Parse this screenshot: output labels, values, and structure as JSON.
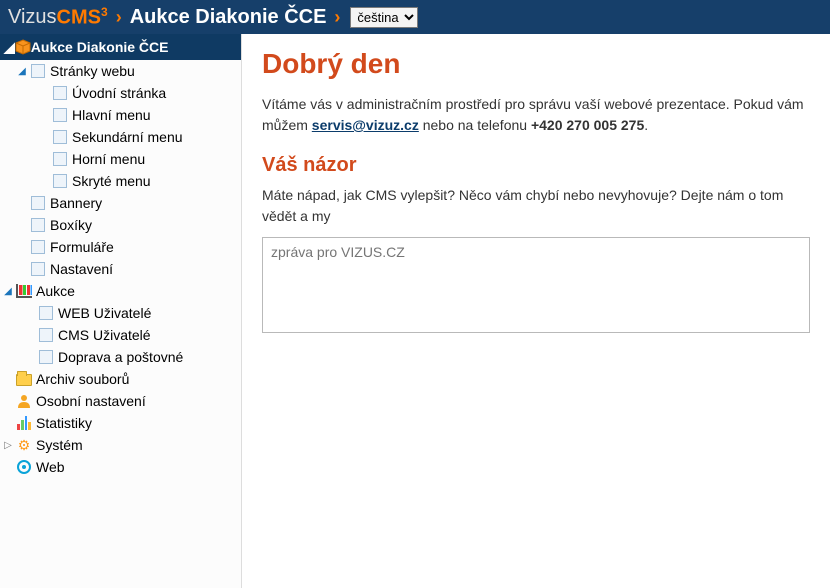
{
  "header": {
    "brand_plain": "Vizus ",
    "brand_bold": "CMS",
    "brand_sup": "3",
    "breadcrumb": "Aukce Diakonie ČCE",
    "lang_selected": "čeština",
    "lang_options": [
      "čeština"
    ]
  },
  "sidebar": {
    "root_label": "Aukce Diakonie ČCE",
    "stranky": {
      "label": "Stránky webu",
      "children": [
        "Úvodní stránka",
        "Hlavní menu",
        "Sekundární menu",
        "Horní menu",
        "Skryté menu"
      ]
    },
    "bannery": "Bannery",
    "boxiky": "Boxíky",
    "formulare": "Formuláře",
    "nastaveni": "Nastavení",
    "aukce": {
      "label": "Aukce",
      "children": [
        "WEB Uživatelé",
        "CMS Uživatelé",
        "Doprava a poštovné"
      ]
    },
    "archiv": "Archiv souborů",
    "osobni": "Osobní nastavení",
    "statistiky": "Statistiky",
    "system": "Systém",
    "web": "Web"
  },
  "main": {
    "h1": "Dobrý den",
    "welcome_pre": "Vítáme vás v administračním prostředí pro správu vaší webové prezentace. Pokud vám můžem",
    "email": "servis@vizuz.cz",
    "welcome_mid": " nebo na telefonu ",
    "phone": "+420 270 005 275",
    "welcome_end": ".",
    "h2": "Váš názor",
    "prompt": "Máte nápad, jak CMS vylepšit? Něco vám chybí nebo nevyhovuje? Dejte nám o tom vědět a my",
    "textarea_placeholder": "zpráva pro VIZUS.CZ"
  }
}
